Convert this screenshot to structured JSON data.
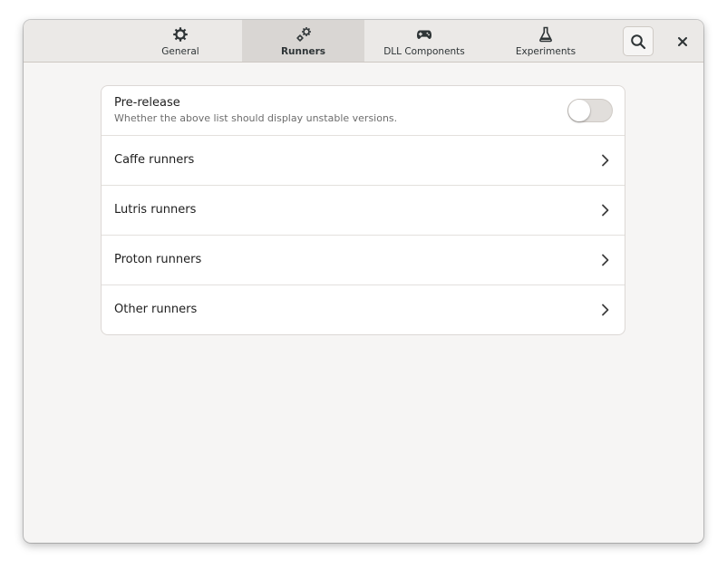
{
  "header": {
    "tabs": [
      {
        "label": "General",
        "icon": "gear-icon",
        "active": false
      },
      {
        "label": "Runners",
        "icon": "gears-icon",
        "active": true
      },
      {
        "label": "DLL Components",
        "icon": "gamepad-icon",
        "active": false
      },
      {
        "label": "Experiments",
        "icon": "flask-icon",
        "active": false
      }
    ],
    "search_icon": "search-icon",
    "close_icon": "close-icon"
  },
  "prerelease": {
    "title": "Pre-release",
    "subtitle": "Whether the above list should display unstable versions.",
    "enabled": false
  },
  "runners": [
    {
      "label": "Caffe runners"
    },
    {
      "label": "Lutris runners"
    },
    {
      "label": "Proton runners"
    },
    {
      "label": "Other runners"
    }
  ],
  "colors": {
    "window_bg": "#f6f5f4",
    "headerbar_bg": "#ebe9e7",
    "active_tab_bg": "#d9d6d3",
    "text": "#1e1e1e",
    "subtext": "#6d6d6d"
  }
}
